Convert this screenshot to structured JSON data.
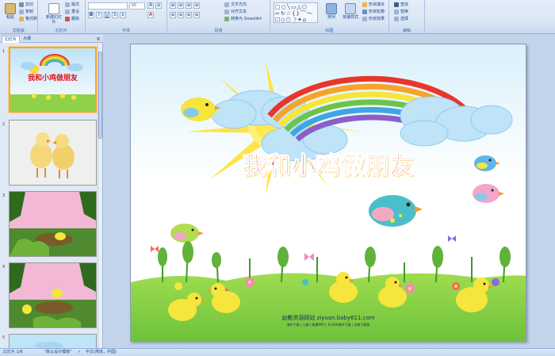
{
  "ribbon": {
    "clipboard": {
      "paste": "粘贴",
      "cut": "剪切",
      "copy": "复制",
      "format_painter": "格式刷",
      "label": "剪贴板"
    },
    "slides": {
      "new_slide": "新建幻灯片",
      "layout": "版式",
      "reset": "重设",
      "delete": "删除",
      "label": "幻灯片"
    },
    "font": {
      "font_name": "",
      "font_size": "66",
      "label": "字体"
    },
    "paragraph": {
      "text_direction": "文字方向",
      "align_text": "对齐文本",
      "smartart": "转换为 SmartArt",
      "label": "段落"
    },
    "drawing": {
      "arrange": "排列",
      "quick_styles": "快速样式",
      "shape_fill": "形状填充",
      "shape_outline": "形状轮廓",
      "shape_effects": "形状效果",
      "label": "绘图"
    },
    "editing": {
      "find": "查找",
      "replace": "替换",
      "select": "选择",
      "label": "编辑"
    }
  },
  "panel": {
    "tabs": [
      "幻灯片",
      "大纲"
    ],
    "close": "×",
    "slide_numbers": [
      "1",
      "2",
      "3",
      "4",
      "5"
    ]
  },
  "slide": {
    "title": "我和小鸡做朋友",
    "site_name": "幼教资源网站 ziyuan.baby611.com",
    "site_links": "课件下载 | 儿歌 | 故事MP3 | FLASH课件下载 | 试卷下载版"
  },
  "thumb1": {
    "title": "我和小鸡做朋友"
  },
  "status": {
    "slide_info": "幻灯片 1/6",
    "theme": "\"默认设计模板\"",
    "language": "中文(简体，中国)"
  },
  "colors": {
    "accent": "#15428b",
    "title_red": "#e8131a",
    "selection": "#f6a23c"
  }
}
